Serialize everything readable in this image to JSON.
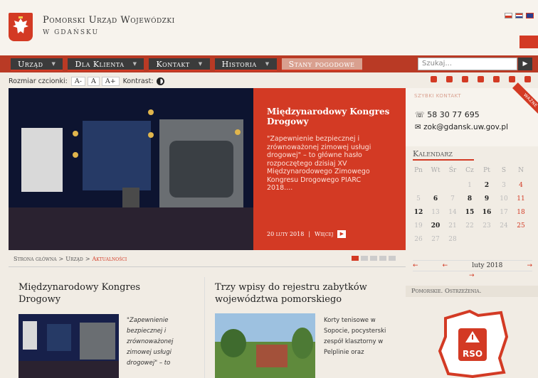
{
  "header": {
    "brand_line1": "Pomorski Urząd Wojewódzki",
    "brand_line2": "W GDAŃSKU",
    "flags": [
      "pl-flag",
      "pl-sign-flag",
      "en-flag"
    ]
  },
  "nav": {
    "items": [
      {
        "label": "Urząd"
      },
      {
        "label": "Dla Klienta"
      },
      {
        "label": "Kontakt"
      },
      {
        "label": "Historia"
      },
      {
        "label": "Stany pogodowe"
      }
    ],
    "search_placeholder": "Szukaj...",
    "search_button": "▶"
  },
  "toolbar": {
    "font_size_label": "Rozmiar czcionki:",
    "font_small": "A-",
    "font_normal": "A",
    "font_large": "A+",
    "contrast_label": "Kontrast:"
  },
  "slider": {
    "title": "Międzynarodowy Kongres Drogowy",
    "description": "\"Zapewnienie bezpiecznej i zrównoważonej zimowej usługi drogowej\" – to główne hasło rozpoczętego dzisiaj XV Międzynarodowego Zimowego Kongresu Drogowego PIARC 2018....",
    "date": "20 luty 2018",
    "more": "Więcej",
    "active_slide": 1,
    "slide_count": 5
  },
  "contact": {
    "label": "SZYBKI KONTAKT",
    "phone": "58 30 77 695",
    "email": "zok@gdansk.uw.gov.pl",
    "ribbon": "WAŻNE"
  },
  "calendar": {
    "title": "Kalendarz",
    "weekdays": [
      "Pn",
      "Wt",
      "Śr",
      "Cz",
      "Pt",
      "S",
      "N"
    ],
    "days": [
      {
        "d": "",
        "s": ""
      },
      {
        "d": "",
        "s": ""
      },
      {
        "d": "",
        "s": ""
      },
      {
        "d": "1",
        "s": ""
      },
      {
        "d": "2",
        "s": "b"
      },
      {
        "d": "3",
        "s": ""
      },
      {
        "d": "4",
        "s": "r"
      },
      {
        "d": "5",
        "s": ""
      },
      {
        "d": "6",
        "s": "b"
      },
      {
        "d": "7",
        "s": ""
      },
      {
        "d": "8",
        "s": "b"
      },
      {
        "d": "9",
        "s": "b"
      },
      {
        "d": "10",
        "s": ""
      },
      {
        "d": "11",
        "s": "r"
      },
      {
        "d": "12",
        "s": "b"
      },
      {
        "d": "13",
        "s": ""
      },
      {
        "d": "14",
        "s": ""
      },
      {
        "d": "15",
        "s": "b"
      },
      {
        "d": "16",
        "s": "b"
      },
      {
        "d": "17",
        "s": ""
      },
      {
        "d": "18",
        "s": "r"
      },
      {
        "d": "19",
        "s": ""
      },
      {
        "d": "20",
        "s": "b"
      },
      {
        "d": "21",
        "s": ""
      },
      {
        "d": "22",
        "s": ""
      },
      {
        "d": "23",
        "s": ""
      },
      {
        "d": "24",
        "s": ""
      },
      {
        "d": "25",
        "s": "r"
      },
      {
        "d": "26",
        "s": ""
      },
      {
        "d": "27",
        "s": ""
      },
      {
        "d": "28",
        "s": ""
      },
      {
        "d": "",
        "s": ""
      },
      {
        "d": "",
        "s": ""
      },
      {
        "d": "",
        "s": ""
      },
      {
        "d": "",
        "s": ""
      }
    ],
    "month": "luty 2018",
    "prev_year": "←",
    "prev_month": "←",
    "next_month": "→",
    "today_arrow": "→"
  },
  "warnings": {
    "title": "Pomorskie. Ostrzeżenia.",
    "badge": "RSO"
  },
  "breadcrumb": {
    "home": "Strona główna",
    "sep": ">",
    "section": "Urząd",
    "current": "Aktualności"
  },
  "articles": [
    {
      "title": "Międzynarodowy Kongres Drogowy",
      "excerpt": "\"Zapewnienie bezpiecznej i zrównoważonej zimowej usługi drogowej\" – to"
    },
    {
      "title": "Trzy wpisy do rejestru zabytków województwa pomorskiego",
      "excerpt": "Korty tenisowe w Sopocie, pocysterski zespół klasztorny w Pelplinie oraz"
    }
  ],
  "colors": {
    "accent": "#d33a24",
    "nav_dark": "#3b3b3b",
    "background": "#f1ece4"
  }
}
